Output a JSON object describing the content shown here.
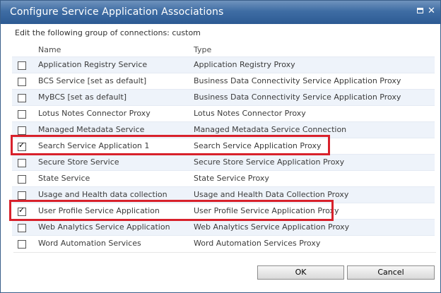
{
  "dialog": {
    "title": "Configure Service Application Associations",
    "subtitle": "Edit the following group of connections: custom"
  },
  "table": {
    "columns": [
      "Name",
      "Type"
    ],
    "rows": [
      {
        "name": "Application Registry Service",
        "type": "Application Registry Proxy",
        "checked": false
      },
      {
        "name": "BCS Service [set as default]",
        "type": "Business Data Connectivity Service Application Proxy",
        "checked": false
      },
      {
        "name": "MyBCS [set as default]",
        "type": "Business Data Connectivity Service Application Proxy",
        "checked": false
      },
      {
        "name": "Lotus Notes Connector Proxy",
        "type": "Lotus Notes Connector Proxy",
        "checked": false
      },
      {
        "name": "Managed Metadata Service",
        "type": "Managed Metadata Service Connection",
        "checked": false
      },
      {
        "name": "Search Service Application 1",
        "type": "Search Service Application Proxy",
        "checked": true
      },
      {
        "name": "Secure Store Service",
        "type": "Secure Store Service Application Proxy",
        "checked": false
      },
      {
        "name": "State Service",
        "type": "State Service Proxy",
        "checked": false
      },
      {
        "name": "Usage and Health data collection",
        "type": "Usage and Health Data Collection Proxy",
        "checked": false
      },
      {
        "name": "User Profile Service Application",
        "type": "User Profile Service Application Proxy",
        "checked": true
      },
      {
        "name": "Web Analytics Service Application",
        "type": "Web Analytics Service Application Proxy",
        "checked": false
      },
      {
        "name": "Word Automation Services",
        "type": "Word Automation Services Proxy",
        "checked": false
      }
    ]
  },
  "buttons": {
    "ok": "OK",
    "cancel": "Cancel"
  },
  "colors": {
    "titlebar": "#2c5a93",
    "highlight": "#d8212b",
    "row_alt": "#eef3fa"
  }
}
